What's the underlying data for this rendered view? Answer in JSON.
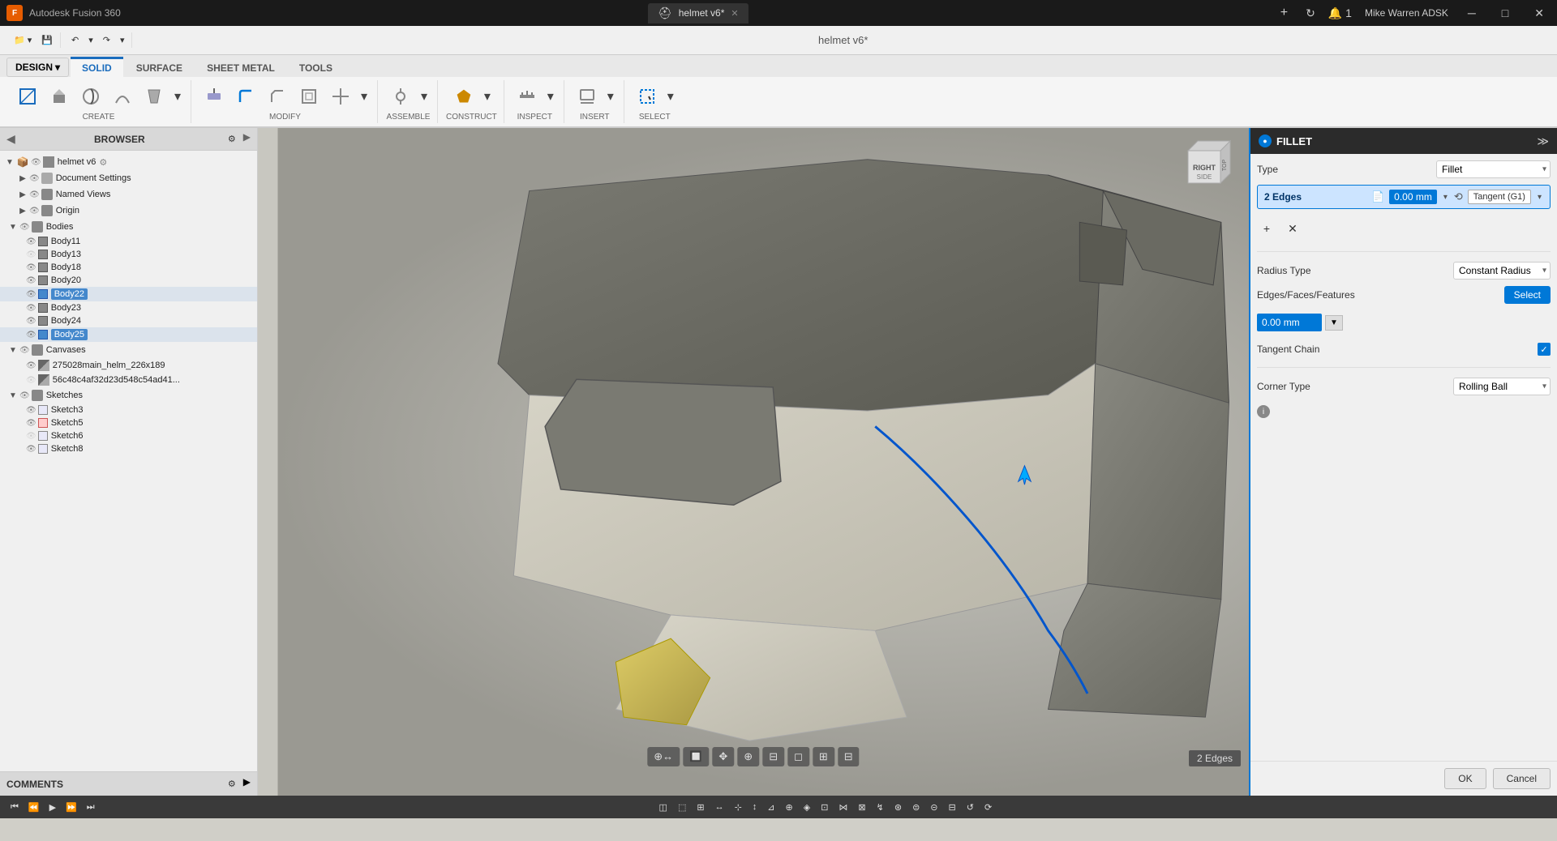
{
  "app": {
    "name": "Autodesk Fusion 360",
    "logo_text": "F"
  },
  "titlebar": {
    "title": "Autodesk Fusion 360",
    "file_name": "helmet v6*",
    "user": "Mike Warren ADSK",
    "minimize": "─",
    "maximize": "□",
    "close": "✕"
  },
  "toolbar": {
    "undo": "↶",
    "redo": "↷"
  },
  "ribbon": {
    "tabs": [
      "SOLID",
      "SURFACE",
      "SHEET METAL",
      "TOOLS"
    ],
    "active_tab": "SOLID",
    "design_label": "DESIGN",
    "sections": {
      "create_label": "CREATE",
      "modify_label": "MODIFY",
      "assemble_label": "ASSEMBLE",
      "construct_label": "CONSTRUCT",
      "inspect_label": "INSPECT",
      "insert_label": "INSERT",
      "select_label": "SELECT"
    }
  },
  "browser": {
    "title": "BROWSER",
    "tree": {
      "root": "helmet v6",
      "items": [
        {
          "label": "Document Settings",
          "level": 1,
          "has_arrow": true,
          "icon": "settings"
        },
        {
          "label": "Named Views",
          "level": 1,
          "has_arrow": false,
          "icon": "folder"
        },
        {
          "label": "Origin",
          "level": 1,
          "has_arrow": false,
          "icon": "origin"
        },
        {
          "label": "Bodies",
          "level": 1,
          "has_arrow": true,
          "icon": "folder",
          "expanded": true
        },
        {
          "label": "Body11",
          "level": 2,
          "icon": "body"
        },
        {
          "label": "Body13",
          "level": 2,
          "icon": "body"
        },
        {
          "label": "Body18",
          "level": 2,
          "icon": "body"
        },
        {
          "label": "Body20",
          "level": 2,
          "icon": "body"
        },
        {
          "label": "Body22",
          "level": 2,
          "icon": "body",
          "selected": true,
          "color": "blue"
        },
        {
          "label": "Body23",
          "level": 2,
          "icon": "body"
        },
        {
          "label": "Body24",
          "level": 2,
          "icon": "body"
        },
        {
          "label": "Body25",
          "level": 2,
          "icon": "body",
          "selected": true,
          "color": "blue"
        },
        {
          "label": "Canvases",
          "level": 1,
          "has_arrow": true,
          "icon": "folder",
          "expanded": true
        },
        {
          "label": "275028main_helm_226x189",
          "level": 2,
          "icon": "canvas"
        },
        {
          "label": "56c48c4af32d23d548c54ad41...",
          "level": 2,
          "icon": "canvas"
        },
        {
          "label": "Sketches",
          "level": 1,
          "has_arrow": true,
          "icon": "folder",
          "expanded": true
        },
        {
          "label": "Sketch3",
          "level": 2,
          "icon": "sketch"
        },
        {
          "label": "Sketch5",
          "level": 2,
          "icon": "sketch"
        },
        {
          "label": "Sketch6",
          "level": 2,
          "icon": "sketch"
        },
        {
          "label": "Sketch8",
          "level": 2,
          "icon": "sketch"
        }
      ]
    }
  },
  "comments": {
    "label": "COMMENTS"
  },
  "fillet_panel": {
    "title": "FILLET",
    "type_label": "Type",
    "type_value": "Fillet",
    "edges_label": "2 Edges",
    "radius_value": "0.00 mm",
    "tangent_label": "Tangent (G1)",
    "add_icon": "+",
    "remove_icon": "✕",
    "radius_type_label": "Radius Type",
    "radius_type_value": "Constant Radius",
    "edges_features_label": "Edges/Faces/Features",
    "select_btn": "Select",
    "mm_value": "0.00 mm",
    "tangent_chain_label": "Tangent Chain",
    "tangent_checked": true,
    "corner_type_label": "Corner Type",
    "corner_type_value": "Rolling Ball",
    "ok_label": "OK",
    "cancel_label": "Cancel"
  },
  "status": {
    "edges_count": "2 Edges"
  },
  "viewport": {
    "nav_icons": [
      "↔",
      "✥",
      "⊕",
      "⊖",
      "◻",
      "⊟",
      "⊞"
    ]
  }
}
